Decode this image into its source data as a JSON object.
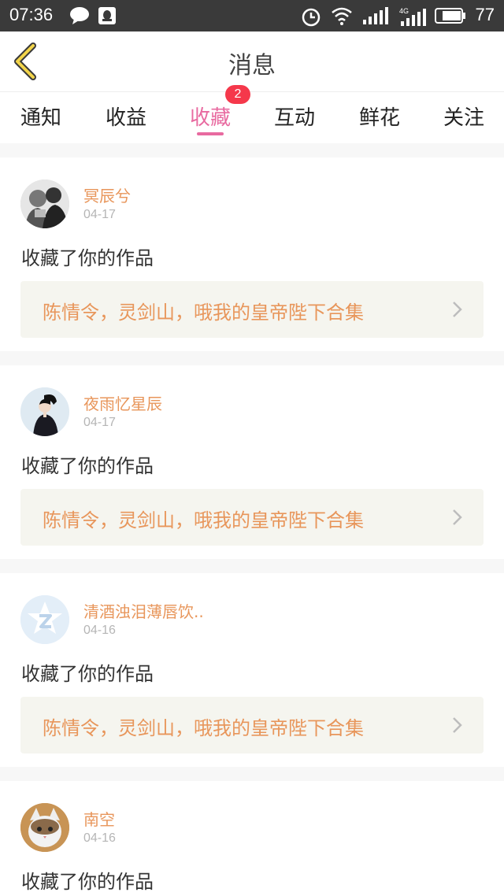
{
  "status_bar": {
    "time": "07:36",
    "battery": "77",
    "icons": [
      "chat-bubble-icon",
      "qq-icon",
      "alarm-icon",
      "wifi-icon",
      "signal-icon",
      "signal-4g-icon",
      "battery-icon"
    ]
  },
  "header": {
    "title": "消息",
    "back_icon": "chevron-left-icon"
  },
  "tabs": {
    "items": [
      {
        "label": "通知"
      },
      {
        "label": "收益"
      },
      {
        "label": "收藏"
      },
      {
        "label": "互动"
      },
      {
        "label": "鲜花"
      },
      {
        "label": "关注"
      }
    ],
    "active": "收藏",
    "badge": "2"
  },
  "feed": [
    {
      "name": "冥辰兮",
      "date": "04-17",
      "action": "收藏了你的作品",
      "work": "陈情令，灵剑山，哦我的皇帝陛下合集"
    },
    {
      "name": "夜雨忆星辰",
      "date": "04-17",
      "action": "收藏了你的作品",
      "work": "陈情令，灵剑山，哦我的皇帝陛下合集"
    },
    {
      "name": "清酒浊泪薄唇饮..",
      "date": "04-16",
      "action": "收藏了你的作品",
      "work": "陈情令，灵剑山，哦我的皇帝陛下合集"
    },
    {
      "name": "南空",
      "date": "04-16",
      "action": "收藏了你的作品"
    }
  ],
  "colors": {
    "accent": "#e86aa0",
    "name": "#e8965b",
    "badge": "#f5384b",
    "status_bar": "#3a3a3a"
  }
}
